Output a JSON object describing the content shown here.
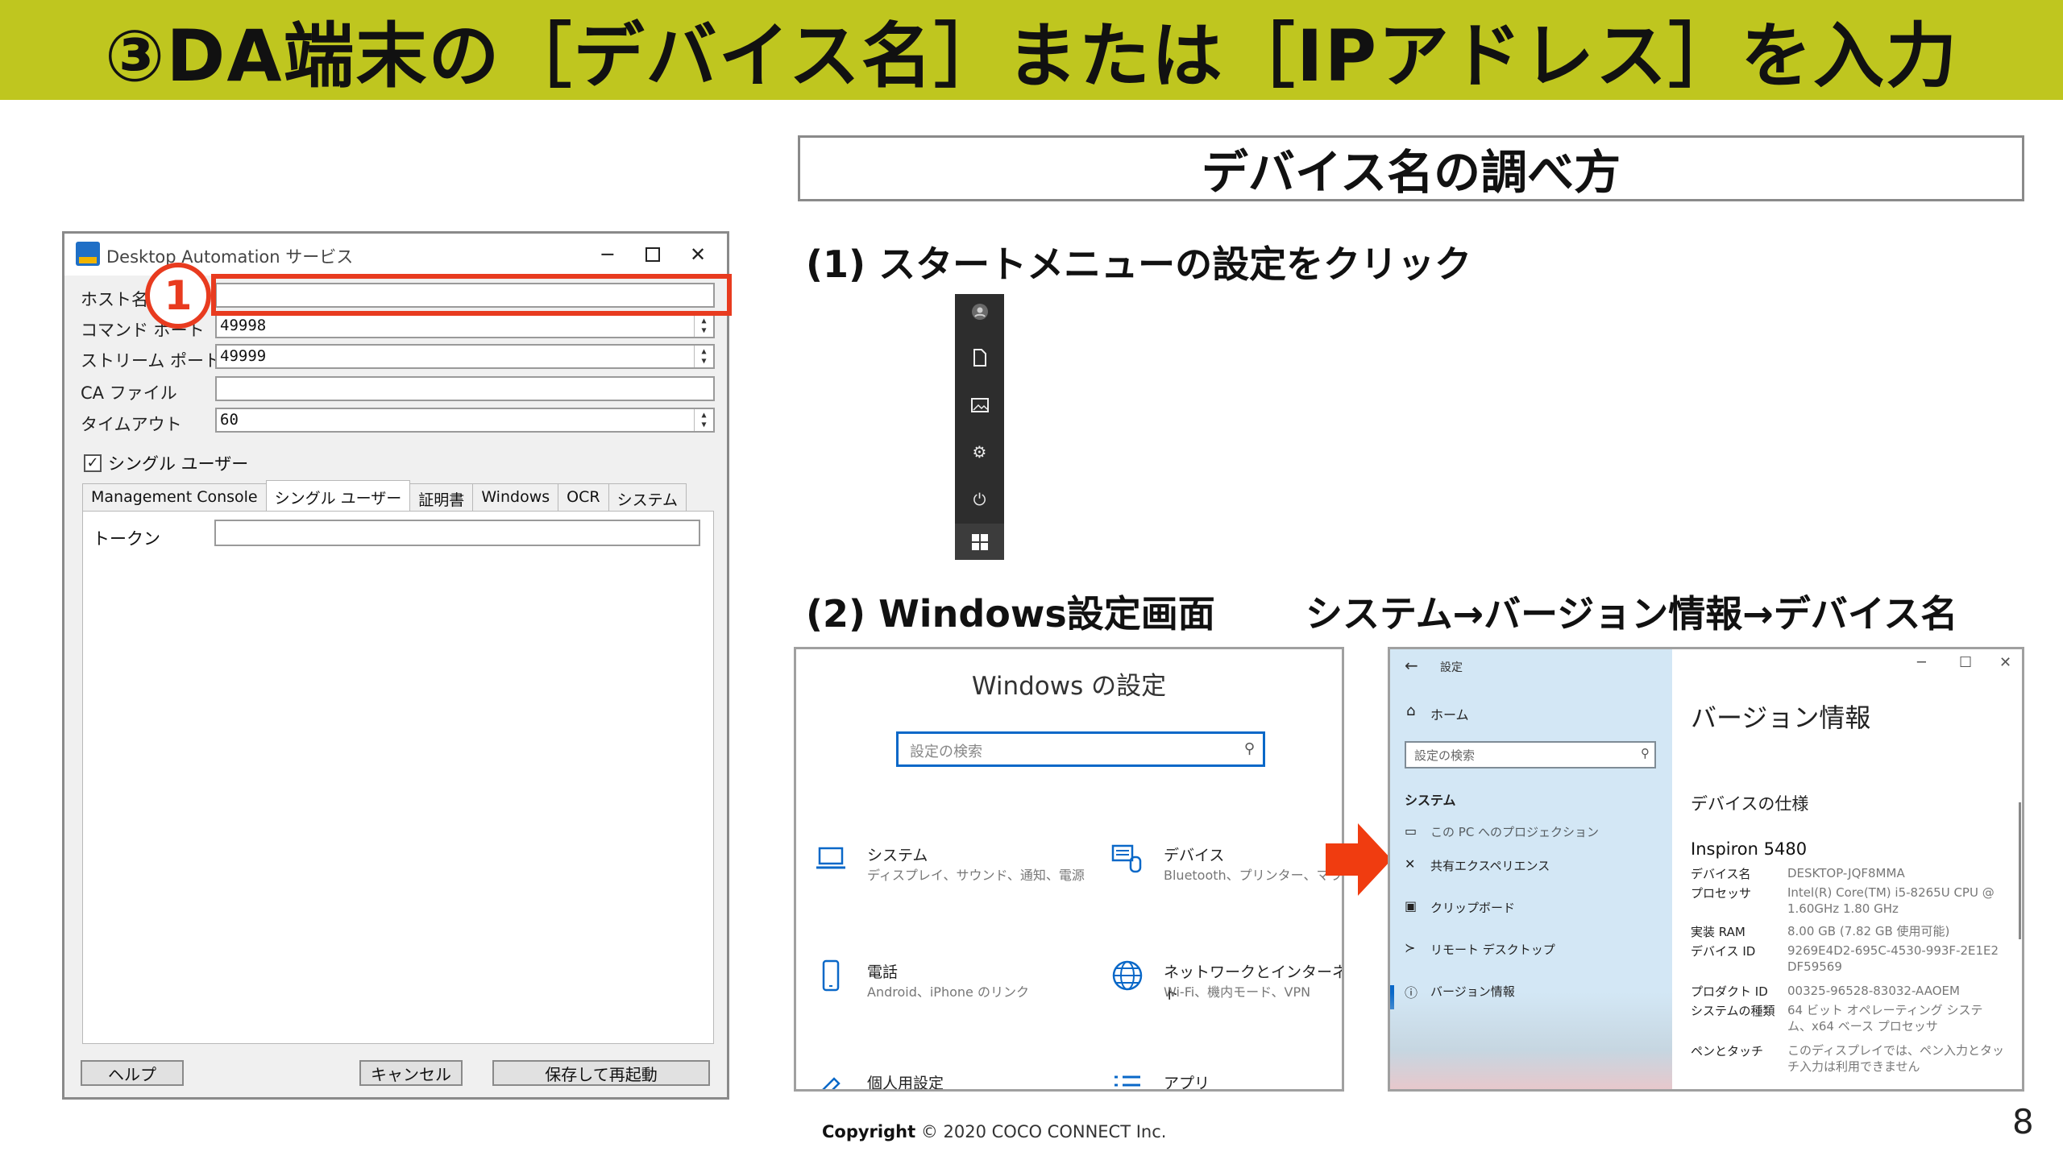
{
  "banner": {
    "title": "③DA端末の［デバイス名］または［IPアドレス］を入力"
  },
  "dialog": {
    "title": "Desktop Automation サービス",
    "controls": {
      "minimize": "─",
      "close": "✕"
    },
    "fields": [
      {
        "label": "ホスト名",
        "value": ""
      },
      {
        "label": "コマンド ポート",
        "value": "49998"
      },
      {
        "label": "ストリーム ポート",
        "value": "49999"
      },
      {
        "label": "CA ファイル",
        "value": ""
      },
      {
        "label": "タイムアウト",
        "value": "60"
      }
    ],
    "checkbox": {
      "label": "シングル ユーザー",
      "checked": true
    },
    "tabs": [
      "Management Console",
      "シングル ユーザー",
      "証明書",
      "Windows",
      "OCR",
      "システム"
    ],
    "active_tab": "シングル ユーザー",
    "token_label": "トークン",
    "buttons": {
      "help": "ヘルプ",
      "cancel": "キャンセル",
      "save_restart": "保存して再起動"
    }
  },
  "callout": {
    "number": "1",
    "color": "#e83b1f"
  },
  "heading": "デバイス名の調べ方",
  "step1": "(1) スタートメニューの設定をクリック",
  "step2_left": "(2)  Windows設定画面",
  "step2_right": "システム→バージョン情報→デバイス名",
  "start_menu": {
    "icons": [
      "user-icon",
      "document-icon",
      "pictures-icon",
      "settings-gear-icon",
      "power-icon",
      "windows-logo-icon"
    ]
  },
  "windows_settings": {
    "title": "Windows の設定",
    "search_placeholder": "設定の検索",
    "items": [
      {
        "name": "システム",
        "sub": "ディスプレイ、サウンド、通知、電源"
      },
      {
        "name": "デバイス",
        "sub": "Bluetooth、プリンター、マウス"
      },
      {
        "name": "電話",
        "sub": "Android、iPhone のリンク"
      },
      {
        "name": "ネットワークとインターネット",
        "sub": "Wi-Fi、機内モード、VPN"
      },
      {
        "name": "個人用設定",
        "sub": ""
      },
      {
        "name": "アプリ",
        "sub": ""
      }
    ],
    "accent": "#0a68c8"
  },
  "about": {
    "app_name": "設定",
    "home": "ホーム",
    "search_placeholder": "設定の検索",
    "section": "システム",
    "nav": [
      "この PC へのプロジェクション",
      "共有エクスペリエンス",
      "クリップボード",
      "リモート デスクトップ",
      "バージョン情報"
    ],
    "page_title": "バージョン情報",
    "spec_heading": "デバイスの仕様",
    "model": "Inspiron 5480",
    "specs": [
      {
        "k": "デバイス名",
        "v": "DESKTOP-JQF8MMA"
      },
      {
        "k": "プロセッサ",
        "v": "Intel(R) Core(TM) i5-8265U CPU @ 1.60GHz   1.80 GHz"
      },
      {
        "k": "実装 RAM",
        "v": "8.00 GB (7.82 GB 使用可能)"
      },
      {
        "k": "デバイス ID",
        "v": "9269E4D2-695C-4530-993F-2E1E2DF59569"
      },
      {
        "k": "プロダクト ID",
        "v": "00325-96528-83032-AAOEM"
      },
      {
        "k": "システムの種類",
        "v": "64 ビット オペレーティング システム、x64 ベース プロセッサ"
      },
      {
        "k": "ペンとタッチ",
        "v": "このディスプレイでは、ペン入力とタッチ入力は利用できません"
      }
    ]
  },
  "footer": {
    "copyright_label": "Copyright",
    "copyright_text": "© 2020 COCO CONNECT Inc.",
    "page_number": "8"
  },
  "colors": {
    "banner": "#bfc61f",
    "highlight": "#e83b1f",
    "arrow": "#f03c10"
  }
}
